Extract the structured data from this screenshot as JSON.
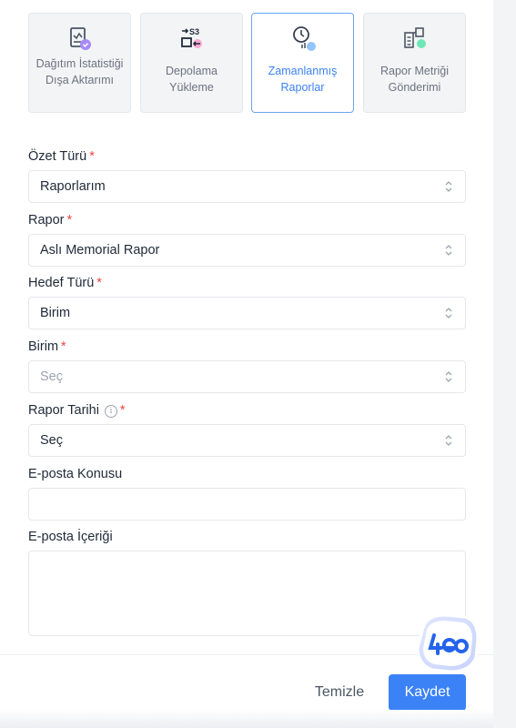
{
  "tabs": [
    {
      "label": "Dağıtım İstatistiği Dışa Aktarımı",
      "icon": "distribution-export-icon",
      "active": false
    },
    {
      "label": "Depolama Yükleme",
      "icon": "s3-upload-icon",
      "active": false
    },
    {
      "label": "Zamanlanmış Raporlar",
      "icon": "scheduled-report-icon",
      "active": true
    },
    {
      "label": "Rapor Metriği Gönderimi",
      "icon": "report-metric-icon",
      "active": false
    }
  ],
  "form": {
    "summary_type": {
      "label": "Özet Türü",
      "value": "Raporlarım"
    },
    "report": {
      "label": "Rapor",
      "value": "Aslı Memorial Rapor"
    },
    "target_type": {
      "label": "Hedef Türü",
      "value": "Birim"
    },
    "unit": {
      "label": "Birim",
      "placeholder": "Seç"
    },
    "report_date": {
      "label": "Rapor Tarihi",
      "value": "Seç"
    },
    "email_subject": {
      "label": "E-posta Konusu",
      "value": ""
    },
    "email_body": {
      "label": "E-posta İçeriği",
      "value": ""
    },
    "required_mark": "*",
    "info_mark": "i"
  },
  "footer": {
    "clear_label": "Temizle",
    "save_label": "Kaydet"
  },
  "colors": {
    "accent": "#3b82f6",
    "required": "#ef4444",
    "tab_bg": "#f3f4f6"
  }
}
